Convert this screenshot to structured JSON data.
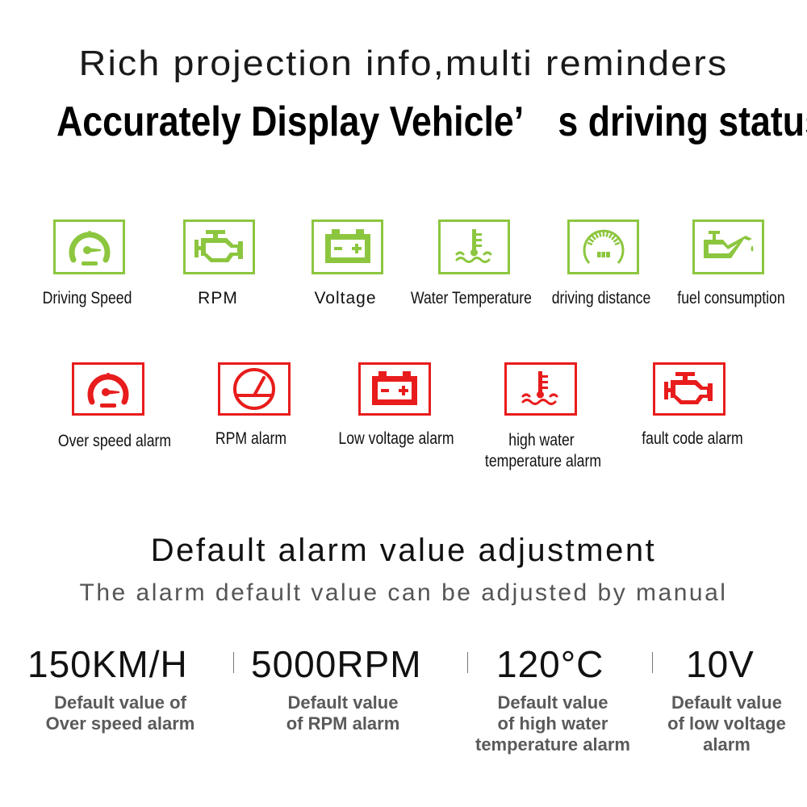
{
  "header": {
    "headline": "Rich projection info,multi reminders",
    "subheadline": "Accurately Display Vehicle’　s driving status"
  },
  "colors": {
    "normal_accent": "#8cc63f",
    "alarm_accent": "#e81c1c",
    "description_text": "#5a5a5a"
  },
  "info_items": [
    {
      "icon": "speedometer-icon",
      "label": "Driving Speed"
    },
    {
      "icon": "engine-icon",
      "label": "RPM"
    },
    {
      "icon": "battery-icon",
      "label": "Voltage"
    },
    {
      "icon": "coolant-temperature-icon",
      "label": "Water Temperature"
    },
    {
      "icon": "odometer-icon",
      "label": "driving distance"
    },
    {
      "icon": "oil-can-icon",
      "label": "fuel consumption"
    }
  ],
  "alarm_items": [
    {
      "icon": "speedometer-icon",
      "label": "Over speed alarm"
    },
    {
      "icon": "tachometer-icon",
      "label": "RPM alarm"
    },
    {
      "icon": "battery-icon",
      "label": "Low voltage alarm"
    },
    {
      "icon": "coolant-temperature-icon",
      "label_line1": "high water",
      "label_line2": "temperature alarm"
    },
    {
      "icon": "engine-icon",
      "label": "fault code alarm"
    }
  ],
  "defaults_section": {
    "title": "Default alarm value adjustment",
    "subtitle": "The alarm default value can be adjusted by manual",
    "values": [
      {
        "value": "150KM/H",
        "desc_lines": [
          "Default value of",
          "Over speed alarm"
        ]
      },
      {
        "value": "5000RPM",
        "desc_lines": [
          "Default value",
          "of RPM alarm"
        ]
      },
      {
        "value": "120°C",
        "desc_lines": [
          "Default value",
          "of high water",
          "temperature alarm"
        ]
      },
      {
        "value": "10V",
        "desc_lines": [
          "Default value",
          "of low voltage",
          "alarm"
        ]
      }
    ]
  }
}
